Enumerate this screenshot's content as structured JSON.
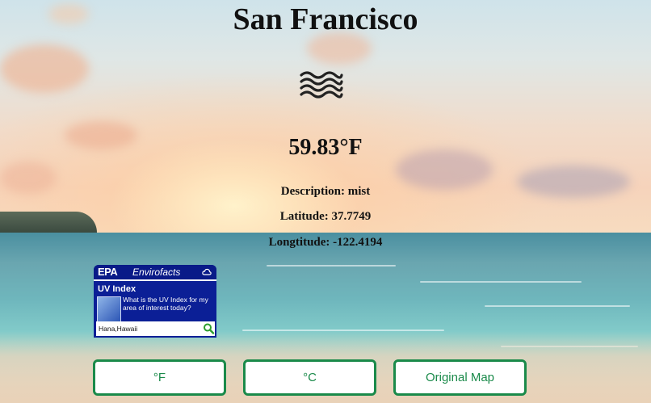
{
  "city": "San Francisco",
  "weather_icon": "mist-waves-icon",
  "temperature": "59.83°F",
  "description": "Description: mist",
  "latitude": "Latitude: 37.7749",
  "longitude": "Longtitude: -122.4194",
  "epa_widget": {
    "logo": "EPA",
    "brand": "Envirofacts",
    "heading": "UV Index",
    "question": "What is the UV Index for my area of interest today?",
    "search_value": "Hana,Hawaii"
  },
  "buttons": {
    "fahrenheit": "°F",
    "celsius": "°C",
    "map": "Original Map"
  },
  "colors": {
    "button_accent": "#1a8a4a",
    "epa_blue": "#0b1f96"
  }
}
